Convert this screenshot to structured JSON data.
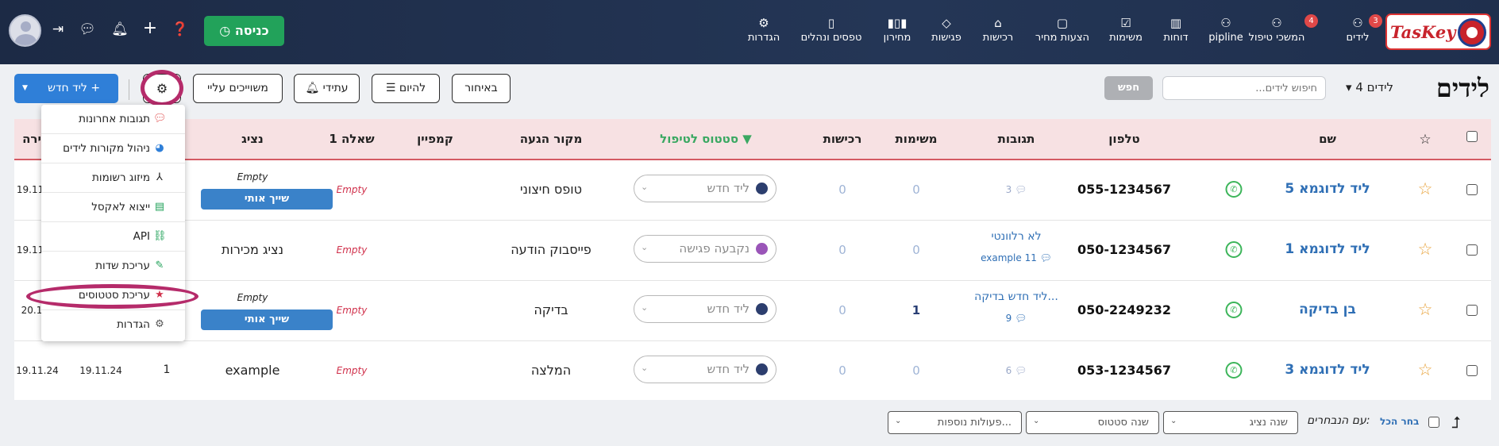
{
  "app": {
    "brand": "TasKey",
    "accent": "#2f7fd8",
    "nav_bg": "#1c2a45"
  },
  "nav": {
    "items": [
      {
        "label": "לידים",
        "icon": "award-icon",
        "badge": "3"
      },
      {
        "label": "המשכי טיפול",
        "icon": "award-icon",
        "badge": "4"
      },
      {
        "label": "pipline",
        "icon": "award-icon"
      },
      {
        "label": "דוחות",
        "icon": "bar-chart-icon"
      },
      {
        "label": "משימות",
        "icon": "check-square-icon"
      },
      {
        "label": "הצעות מחיר",
        "icon": "file-icon"
      },
      {
        "label": "רכישות",
        "icon": "factory-icon"
      },
      {
        "label": "פגישות",
        "icon": "handshake-icon"
      },
      {
        "label": "מחירון",
        "icon": "barcode-icon"
      },
      {
        "label": "טפסים ונהלים",
        "icon": "book-icon"
      },
      {
        "label": "הגדרות",
        "icon": "gear-icon"
      }
    ],
    "enter_label": "כניסה"
  },
  "page": {
    "title": "לידים",
    "count_label": "4 לידים",
    "search_placeholder": "חיפוש לידים...",
    "search_button": "חפש"
  },
  "filters": {
    "overdue": "באיחור",
    "today": "להיום",
    "future": "עתידי",
    "mine": "משוייכים עליי",
    "new_lead": "ליד חדש"
  },
  "table": {
    "headers": {
      "name": "שם",
      "phone": "טלפון",
      "responses": "תגובות",
      "tasks": "משימות",
      "purchases": "רכישות",
      "status": "סטטוס לטיפול",
      "source": "מקור הגעה",
      "campaign": "קמפיין",
      "question": "שאלה 1",
      "rep": "נציג",
      "created": "ירה"
    },
    "rows": [
      {
        "name": "ליד לדוגמא 5",
        "phone": "055-1234567",
        "resp_title": "",
        "resp_count": "3",
        "tasks": "0",
        "purchases": "0",
        "status": "ליד חדש",
        "status_color": "#2c3e6e",
        "source": "טופס חיצוני",
        "question": "Empty",
        "rep_top": "Empty",
        "rep": "",
        "assign": "שייך אותי",
        "created": "19.11.",
        "updated": "",
        "campaign": ""
      },
      {
        "name": "ליד לדוגמא 1",
        "phone": "050-1234567",
        "resp_title": "לא רלוונטי",
        "resp_count": "example 11",
        "tasks": "0",
        "purchases": "0",
        "status": "נקבעה פגישה",
        "status_color": "#9a55b8",
        "source": "פייסבוק הודעה",
        "question": "Empty",
        "rep_top": "",
        "rep": "נציג מכירות",
        "assign": "",
        "created": "19.11.",
        "updated": "",
        "campaign": ""
      },
      {
        "name": "בן בדיקה",
        "phone": "050-2249232",
        "resp_title": "ליד חדש בדיקה...",
        "resp_count": "9",
        "tasks": "1",
        "purchases": "0",
        "status": "ליד חדש",
        "status_color": "#2c3e6e",
        "source": "בדיקה",
        "question": "Empty",
        "rep_top": "Empty",
        "rep": "",
        "assign": "שייך אותי",
        "created": "20.1",
        "updated": "",
        "campaign": ""
      },
      {
        "name": "ליד לדוגמא 3",
        "phone": "053-1234567",
        "resp_title": "",
        "resp_count": "6",
        "tasks": "0",
        "purchases": "0",
        "status": "ליד חדש",
        "status_color": "#2c3e6e",
        "source": "המלצה",
        "question": "Empty",
        "rep_top": "",
        "rep": "example",
        "assign": "",
        "created": "19.11.24",
        "updated": "19.11.24",
        "campaign": "1"
      }
    ]
  },
  "menu": {
    "items": [
      {
        "label": "תגובות אחרונות",
        "icon": "chat-icon",
        "color": "#e04848",
        "glyph": "💬"
      },
      {
        "label": "ניהול מקורות לידים",
        "icon": "pie-chart-icon",
        "color": "#2f7fd8",
        "glyph": "◕"
      },
      {
        "label": "מיזוג רשומות",
        "icon": "merge-icon",
        "color": "#333",
        "glyph": "⅄"
      },
      {
        "label": "ייצוא לאקסל",
        "icon": "excel-export-icon",
        "color": "#22a25a",
        "glyph": "▤"
      },
      {
        "label": "API",
        "icon": "link-icon",
        "color": "#22a25a",
        "glyph": "🔗"
      },
      {
        "label": "עריכת שדות",
        "icon": "edit-icon",
        "color": "#22a25a",
        "glyph": "✎"
      },
      {
        "label": "עריכת סטטוסים",
        "icon": "star-icon",
        "color": "#d0304b",
        "glyph": "★"
      },
      {
        "label": "הגדרות",
        "icon": "gear-icon",
        "color": "#555",
        "glyph": "⚙"
      }
    ]
  },
  "bulk": {
    "select_all": "בחר הכל",
    "with_selected": "עם הנבחרים:",
    "change_rep": "שנה נציג",
    "change_status": "שנה סטטוס",
    "more_actions": "פעולות נוספות..."
  }
}
